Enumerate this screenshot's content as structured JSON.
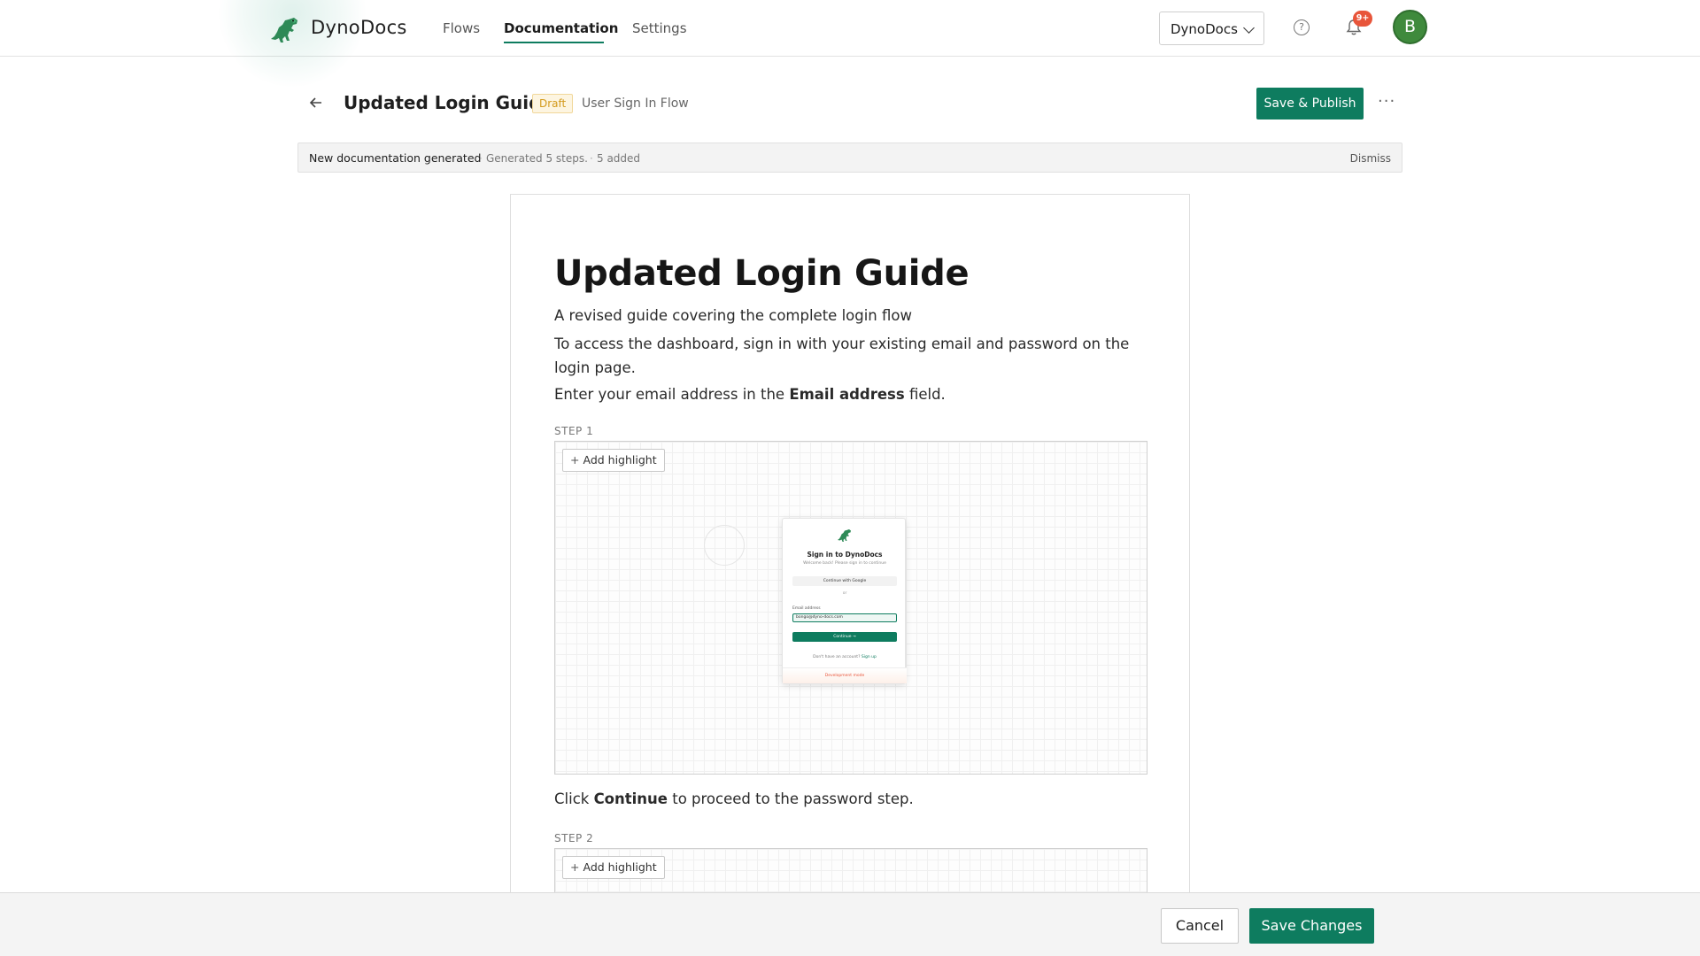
{
  "nav": {
    "brand": "DynoDocs",
    "links": [
      "Flows",
      "Documentation",
      "Settings"
    ],
    "active_link": "Documentation",
    "workspace": "DynoDocs",
    "notification_badge": "9+",
    "avatar_initial": "B",
    "help_symbol": "?"
  },
  "header": {
    "title": "Updated Login Guide",
    "status_badge": "Draft",
    "flow_name": "User Sign In Flow",
    "publish_label": "Save & Publish",
    "more_label": "···"
  },
  "banner": {
    "title": "New documentation generated",
    "separator": "·",
    "detail": "Generated 5 steps.",
    "added": "5 added",
    "dismiss": "Dismiss"
  },
  "document": {
    "heading": "Updated Login Guide",
    "subtitle": "A revised guide covering the complete login flow",
    "intro": "To access the dashboard, sign in with your existing email and password on the login page.",
    "step1_text": {
      "before": "Enter your email address in the ",
      "bold": "Email address",
      "after": " field."
    },
    "step1_label": "STEP 1",
    "add_highlight": "Add highlight",
    "add_highlight_icon": "+",
    "step2_text": {
      "before": "Click ",
      "bold": "Continue",
      "after": " to proceed to the password step."
    },
    "step2_label": "STEP 2"
  },
  "mini_login": {
    "title": "Sign in to DynoDocs",
    "subtitle": "Welcome back! Please sign in to continue",
    "google": "Continue with Google",
    "or": "or",
    "email_label": "Email address",
    "email_value": "bongo@dyno-docs.com",
    "continue": "Continue →",
    "footer_text": "Don't have an account?",
    "footer_link": "Sign up",
    "dev_mode": "Development mode"
  },
  "footer": {
    "cancel": "Cancel",
    "save": "Save Changes"
  },
  "colors": {
    "accent": "#0e7c5f",
    "badge": "#e8553a",
    "draft": "#d39a1c",
    "avatar": "#3f8a3c"
  },
  "icons": [
    "dino-logo-icon",
    "chevron-down-icon",
    "help-icon",
    "bell-icon",
    "back-arrow-icon",
    "more-icon",
    "plus-icon"
  ]
}
